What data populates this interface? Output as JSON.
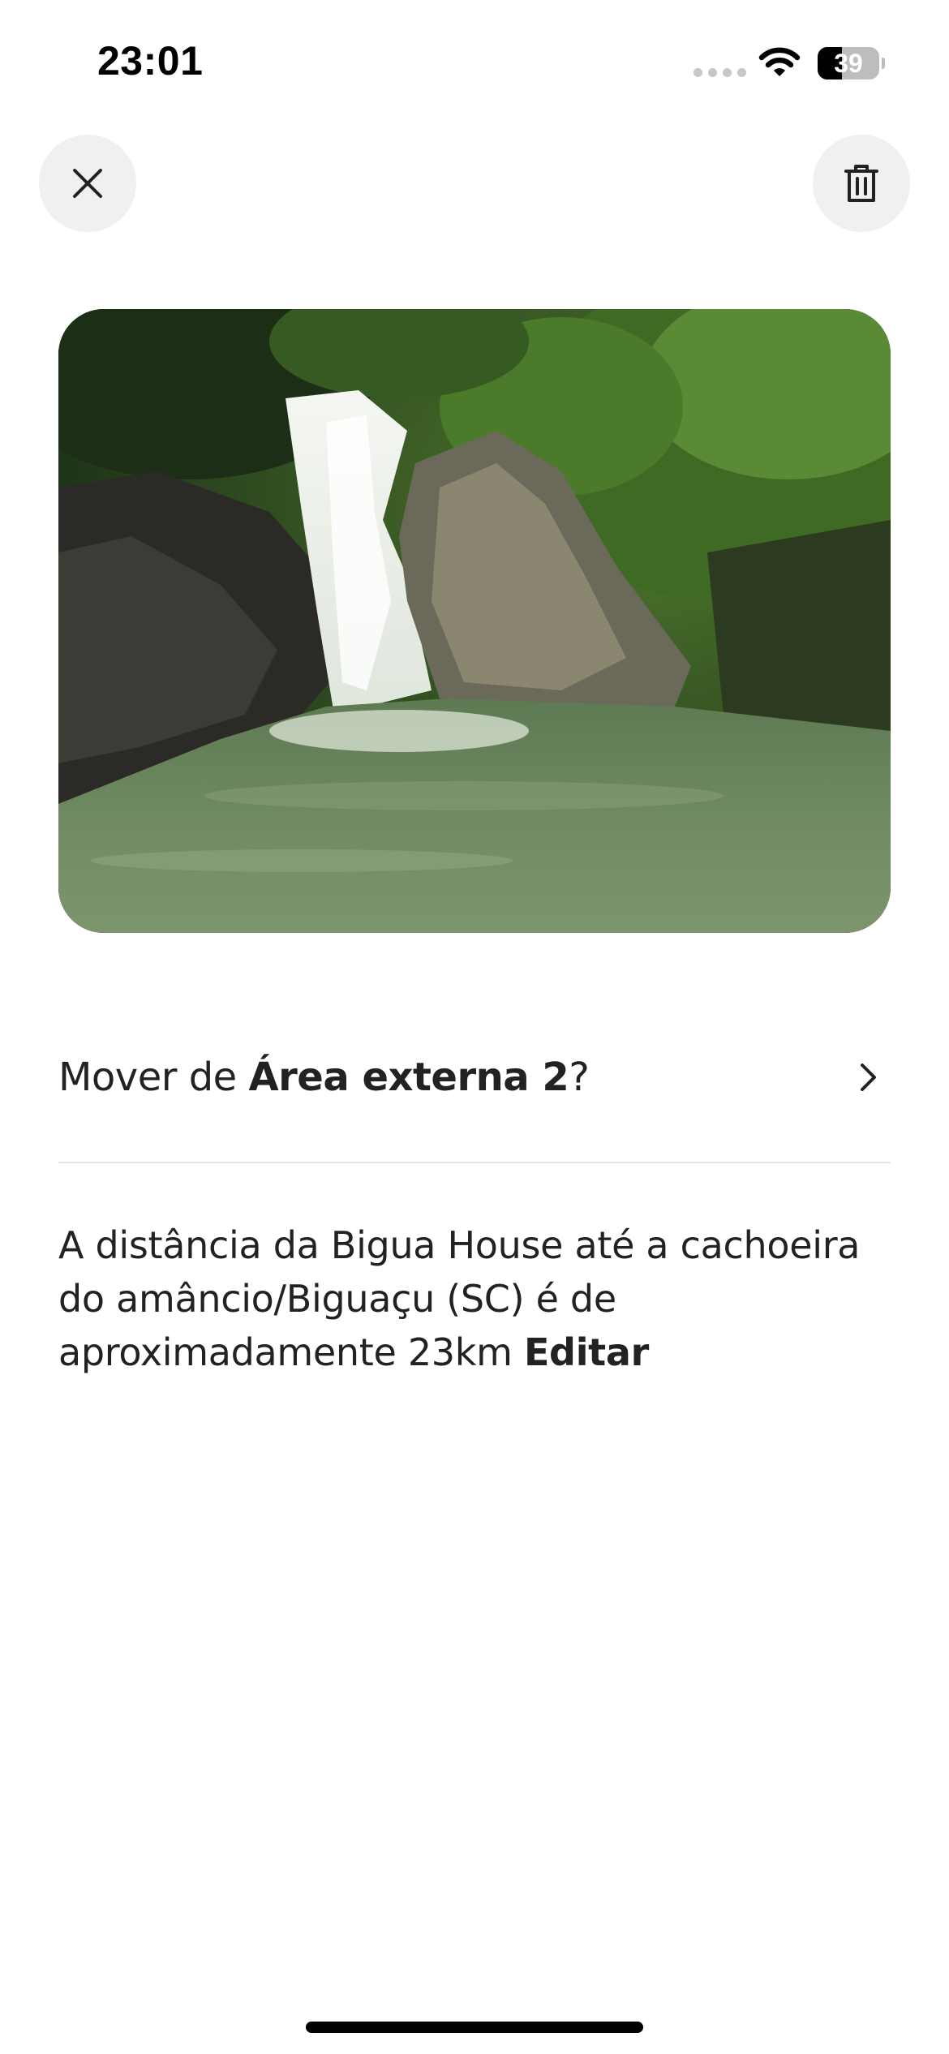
{
  "status_bar": {
    "time": "23:01",
    "battery_level": "39",
    "battery_fraction": 0.39
  },
  "header": {
    "close_icon": "close-icon",
    "delete_icon": "trash-icon"
  },
  "photo": {
    "subject": "waterfall-photo"
  },
  "move_row": {
    "prefix": "Mover de ",
    "area_name": "Área externa 2",
    "suffix": "?",
    "icon": "chevron-right-icon"
  },
  "description": {
    "text": "A distância da Bigua House até a cachoeira do amâncio/Biguaçu (SC) é de aproximadamente 23km ",
    "edit_label": "Editar"
  },
  "colors": {
    "text": "#222222",
    "button_bg": "#f0f0f0",
    "divider": "#e4e4e4"
  }
}
